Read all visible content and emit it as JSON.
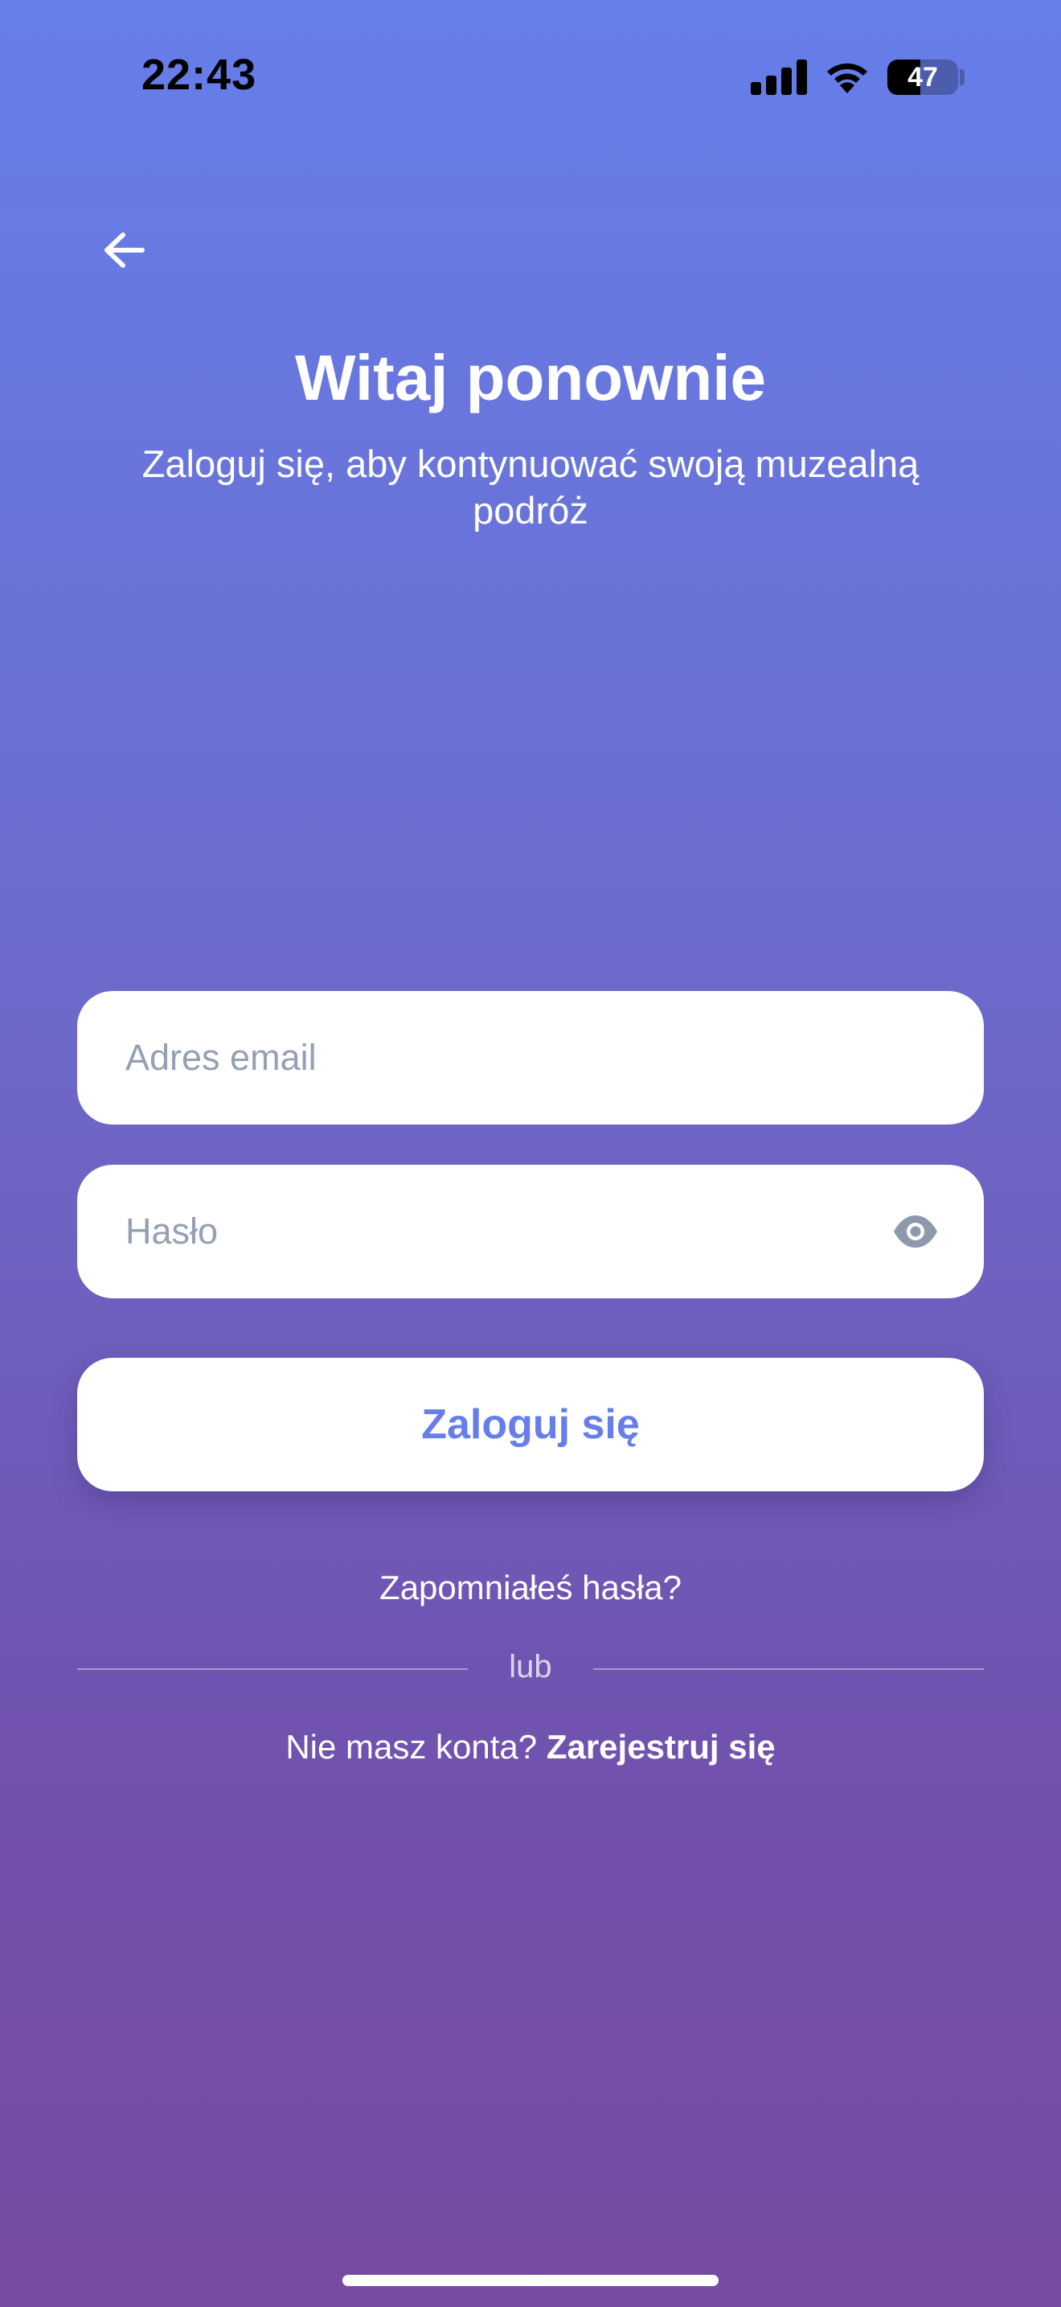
{
  "status_bar": {
    "time": "22:43",
    "battery_level": "47"
  },
  "header": {
    "back_icon": "arrow-left-icon",
    "title": "Witaj ponownie",
    "subtitle": "Zaloguj się, aby kontynuować swoją muzealną podróż"
  },
  "form": {
    "email_placeholder": "Adres email",
    "email_value": "",
    "password_placeholder": "Hasło",
    "password_value": "",
    "password_toggle_icon": "eye-icon",
    "login_label": "Zaloguj się"
  },
  "links": {
    "forgot_password": "Zapomniałeś hasła?",
    "divider": "lub",
    "no_account": "Nie masz konta?",
    "register": "Zarejestruj się"
  },
  "colors": {
    "gradient_top": "#667eea",
    "gradient_bottom": "#764ba2",
    "accent": "#667eea",
    "placeholder": "#94a0b4"
  }
}
